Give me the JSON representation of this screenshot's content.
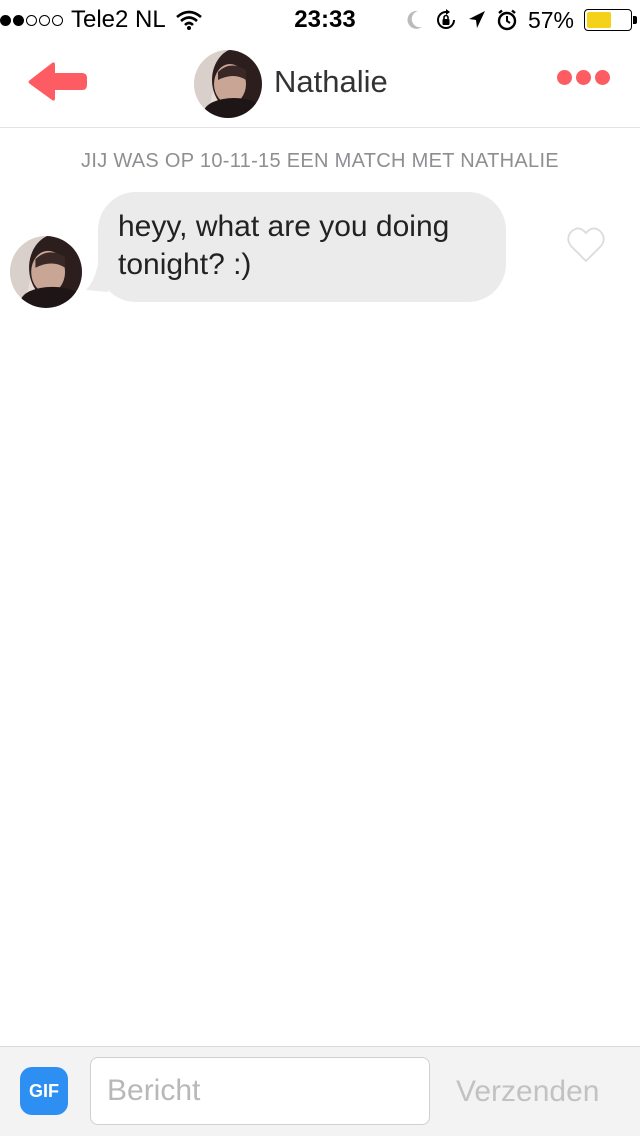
{
  "status_bar": {
    "signal_filled": 2,
    "signal_total": 5,
    "carrier": "Tele2 NL",
    "time": "23:33",
    "battery_percent_label": "57%",
    "battery_level": 0.57,
    "battery_color": "#f5d21a"
  },
  "header": {
    "contact_name": "Nathalie",
    "accent_color": "#fd5c63",
    "back_icon": "back-arrow-icon",
    "more_icon": "more-dots-icon"
  },
  "chat": {
    "match_notice": "JIJ WAS OP 10-11-15 EEN MATCH MET NATHALIE",
    "messages": [
      {
        "from": "Nathalie",
        "text": "heyy, what are you doing tonight? :)",
        "liked": false
      }
    ]
  },
  "composer": {
    "gif_label": "GIF",
    "input_placeholder": "Bericht",
    "input_value": "",
    "send_label": "Verzenden"
  }
}
